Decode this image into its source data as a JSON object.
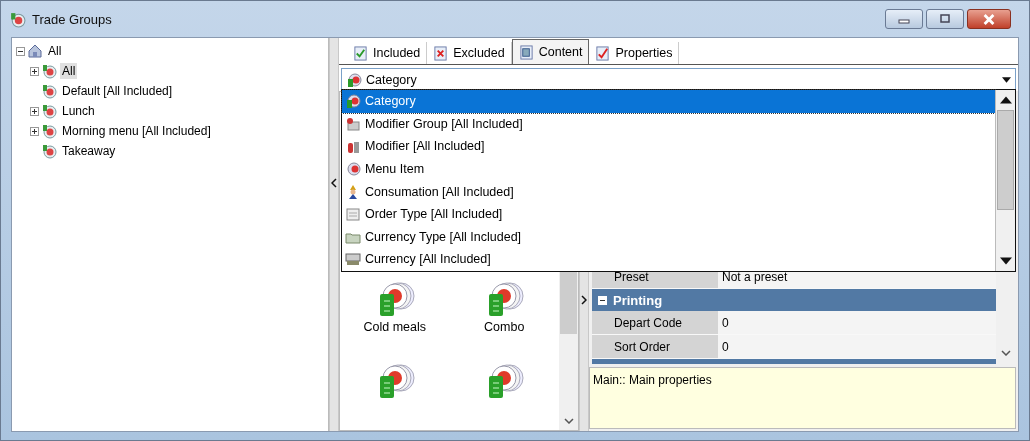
{
  "window": {
    "title": "Trade Groups"
  },
  "tree": [
    {
      "label": "All",
      "expanded": true,
      "selected": false,
      "children": [
        {
          "label": "All",
          "expanded": false,
          "selected": true
        },
        {
          "label": "Default [All Included]",
          "selected": false
        },
        {
          "label": "Lunch",
          "expanded": false,
          "selected": false
        },
        {
          "label": "Morning menu [All Included]",
          "expanded": false,
          "selected": false
        },
        {
          "label": "Takeaway",
          "selected": false
        }
      ]
    }
  ],
  "tabs": [
    {
      "label": "Included",
      "selected": false
    },
    {
      "label": "Excluded",
      "selected": false
    },
    {
      "label": "Content",
      "selected": true
    },
    {
      "label": "Properties",
      "selected": false
    }
  ],
  "combo": {
    "value": "Category",
    "open": true
  },
  "dropdown_items": [
    {
      "label": "Category",
      "selected": true
    },
    {
      "label": "Modifier Group [All Included]",
      "selected": false
    },
    {
      "label": "Modifier [All Included]",
      "selected": false
    },
    {
      "label": "Menu Item",
      "selected": false
    },
    {
      "label": "Consumation [All Included]",
      "selected": false
    },
    {
      "label": "Order Type [All Included]",
      "selected": false
    },
    {
      "label": "Currency Type [All Included]",
      "selected": false
    },
    {
      "label": "Currency [All Included]",
      "selected": false
    }
  ],
  "content_items": [
    {
      "kind": "labeled",
      "label": "Cold meals"
    },
    {
      "kind": "labeled",
      "label": "Combo"
    },
    {
      "kind": "icon"
    },
    {
      "kind": "icon"
    }
  ],
  "properties": {
    "rows": [
      {
        "name": "Preset",
        "value": "Not a preset"
      }
    ],
    "sections": [
      {
        "title": "Printing",
        "expanded": true,
        "rows": [
          {
            "name": "Depart Code",
            "value": "0"
          },
          {
            "name": "Sort Order",
            "value": "0"
          }
        ]
      }
    ]
  },
  "description": "Main:: Main properties"
}
